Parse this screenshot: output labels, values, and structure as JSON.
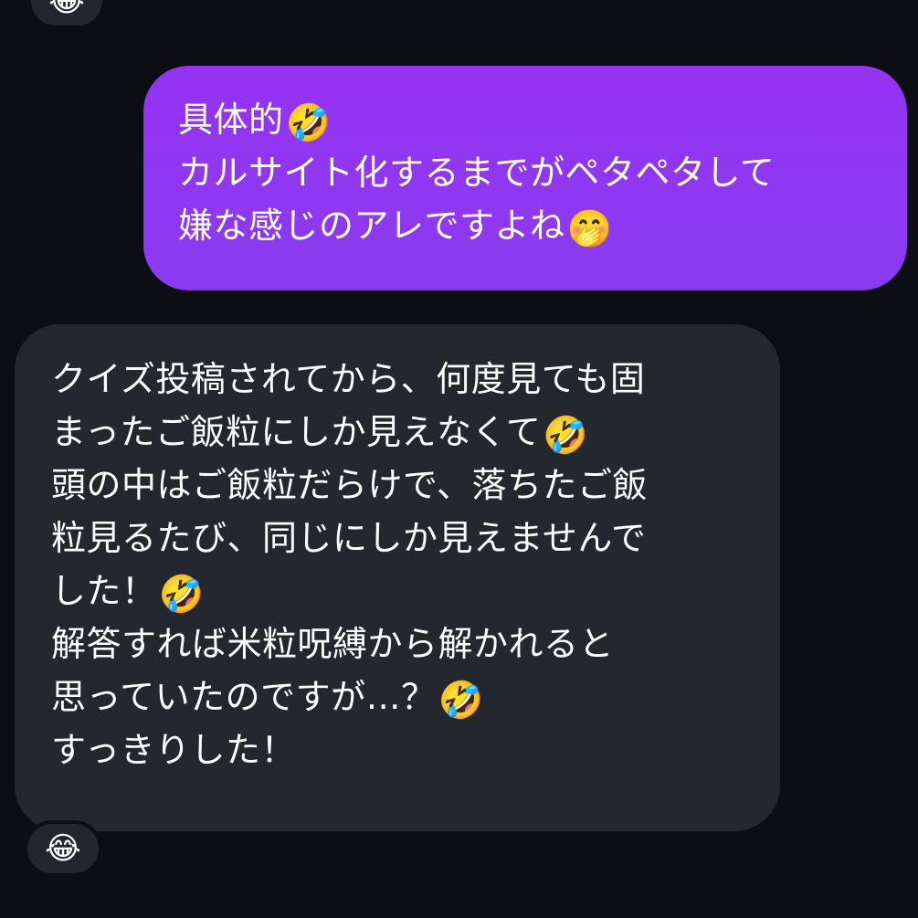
{
  "conversation": {
    "top_reaction": "😂",
    "outgoing_message": {
      "lines": [
        {
          "text": "具体的",
          "emoji": "🤣"
        },
        {
          "text": "カルサイト化するまでがペタペタして",
          "emoji": ""
        },
        {
          "text": "嫌な感じのアレですよね",
          "emoji": "🤭"
        }
      ]
    },
    "incoming_message": {
      "lines": [
        {
          "text": "クイズ投稿されてから、何度見ても固",
          "emoji": ""
        },
        {
          "text": "まったご飯粒にしか見えなくて",
          "emoji": "🤣"
        },
        {
          "text": "頭の中はご飯粒だらけで、落ちたご飯",
          "emoji": ""
        },
        {
          "text": "粒見るたび、同じにしか見えませんで",
          "emoji": ""
        },
        {
          "text": "した！",
          "emoji": "🤣"
        },
        {
          "text": "解答すれば米粒呪縛から解かれると",
          "emoji": ""
        },
        {
          "text": "思っていたのですが…？",
          "emoji": "🤣"
        },
        {
          "text": "すっきりした！",
          "emoji": ""
        }
      ]
    },
    "bottom_reaction": "😂"
  },
  "colors": {
    "background": "#0c0e13",
    "outgoing_bubble": "#9533f2",
    "incoming_bubble": "#24272e",
    "text": "#ffffff"
  }
}
